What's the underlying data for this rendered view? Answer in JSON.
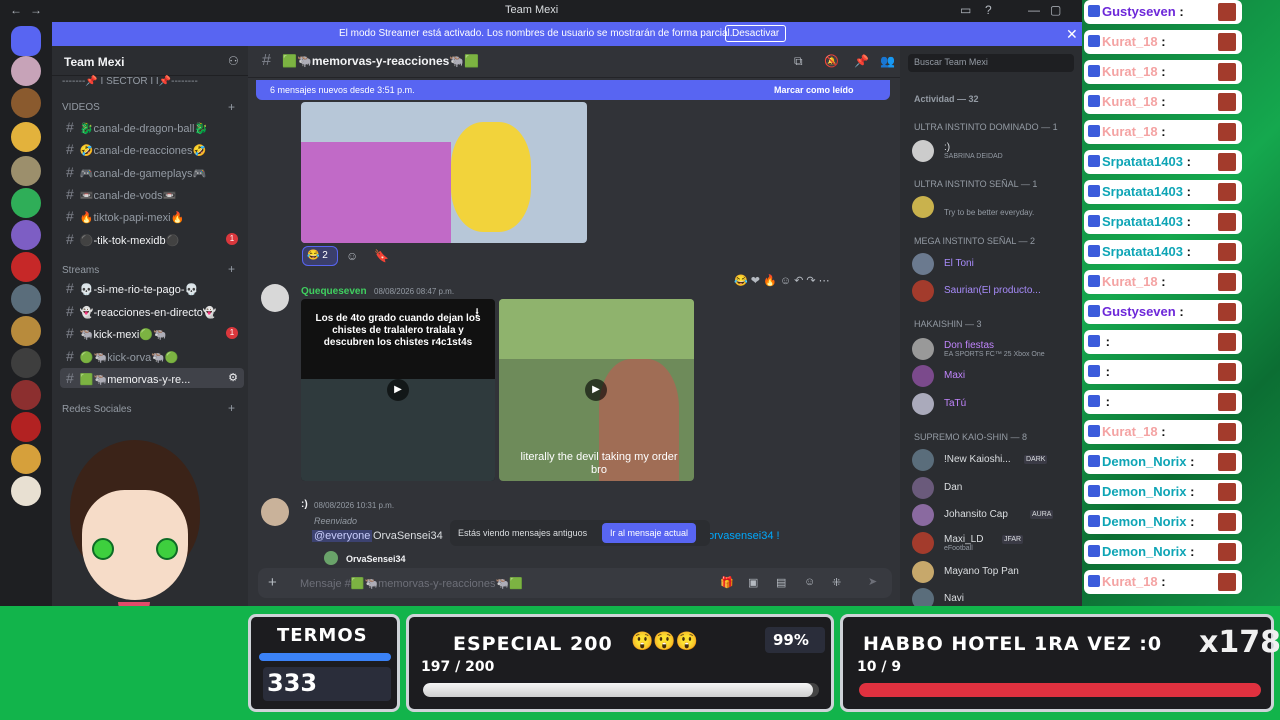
{
  "window": {
    "title": "Team Mexi"
  },
  "banner": {
    "message": "El modo Streamer está activado. Los nombres de usuario se mostrarán de forma parcial.",
    "button": "Desactivar"
  },
  "server": {
    "name": "Team Mexi"
  },
  "sidebar": {
    "cat_sector": "-------📌 I SECTOR I I📌--------",
    "cat_videos": "VIDEOS",
    "cat_streams": "Streams",
    "cat_redes": "Redes Sociales",
    "channels": [
      {
        "label": "🐉canal-de-dragon-ball🐉"
      },
      {
        "label": "🤣canal-de-reacciones🤣"
      },
      {
        "label": "🎮canal-de-gameplays🎮"
      },
      {
        "label": "📼canal-de-vods📼"
      },
      {
        "label": "🔥tiktok-papi-mexi🔥"
      },
      {
        "label": "⚫-tik-tok-mexidb⚫"
      },
      {
        "label": "💀-si-me-rio-te-pago-💀"
      },
      {
        "label": "👻-reacciones-en-directo👻"
      },
      {
        "label": "🐃kick-mexi🟢🐃"
      },
      {
        "label": "🟢🐃kick-orva🐃🟢"
      },
      {
        "label": "🟩🐃memorvas-y-re..."
      }
    ]
  },
  "chat": {
    "channel": "🟩🐃memorvas-y-reacciones🐃🟩",
    "new_messages": "6 mensajes nuevos desde 3:51 p.m.",
    "mark_read": "Marcar como leído",
    "reaction_count": "2",
    "msg1": {
      "author": "Quequeseven",
      "time": "08/08/2026 08:47 p.m."
    },
    "video1_caption": "Los de 4to grado cuando dejan los chistes de tralalero tralala y descubren los chistes r4c1st4s",
    "video2_caption": "literally the devil taking my order bro",
    "msg2": {
      "author": ":)",
      "time": "08/08/2026 10:31 p.m.",
      "forwarded": "Reenviado",
      "mention": "@everyone",
      "text": "OrvaSensei34",
      "link": "orvasensei34 !",
      "embed_author": "OrvaSensei34"
    },
    "old_notice": "Estás viendo mensajes antiguos",
    "jump_button": "Ir al mensaje actual",
    "composer_placeholder": "Mensaje #🟩🐃memorvas-y-reacciones🐃🟩"
  },
  "members": {
    "search_placeholder": "Buscar Team Mexi",
    "activity": "Actividad — 32",
    "groups": [
      {
        "title": "ULTRA INSTINTO DOMINADO — 1",
        "members": [
          {
            "name": ":)",
            "status": "SABRINA DEIDAD",
            "color": "#dbdee1"
          }
        ]
      },
      {
        "title": "ULTRA INSTINTO SEÑAL — 1",
        "members": [
          {
            "name": "Try to be better everyday.",
            "status": "",
            "color": "#949ba4"
          }
        ]
      },
      {
        "title": "MEGA INSTINTO SEÑAL — 2",
        "members": [
          {
            "name": "El Toni",
            "status": "",
            "color": "#a78bfa"
          },
          {
            "name": "Saurian(El producto...",
            "status": "",
            "color": "#a78bfa"
          }
        ]
      },
      {
        "title": "HAKAISHIN — 3",
        "members": [
          {
            "name": "Don fiestas",
            "status": "EA SPORTS FC™ 25 Xbox One",
            "color": "#c084fc"
          },
          {
            "name": "Maxi",
            "status": "",
            "color": "#c084fc"
          },
          {
            "name": "TaTú",
            "status": "",
            "color": "#c084fc"
          }
        ]
      },
      {
        "title": "SUPREMO KAIO-SHIN — 8",
        "members": [
          {
            "name": "!New Kaioshi...",
            "tag": "DARK",
            "status": "",
            "color": "#dbdee1"
          },
          {
            "name": "Dan",
            "status": "",
            "color": "#dbdee1"
          },
          {
            "name": "Johansito Cap",
            "tag": "AURA",
            "status": "",
            "color": "#dbdee1"
          },
          {
            "name": "Maxi_LD",
            "tag": "JFAR",
            "status": "eFootball",
            "color": "#dbdee1"
          },
          {
            "name": "Mayano Top Pan",
            "status": "",
            "color": "#dbdee1"
          },
          {
            "name": "Navi",
            "status": "",
            "color": "#dbdee1"
          }
        ]
      }
    ]
  },
  "overlay_chat": [
    {
      "name": "Gustyseven",
      "color": "#6d28d9"
    },
    {
      "name": "Kurat_18",
      "color": "#f4a3a3"
    },
    {
      "name": "Kurat_18",
      "color": "#f4a3a3"
    },
    {
      "name": "Kurat_18",
      "color": "#f4a3a3"
    },
    {
      "name": "Kurat_18",
      "color": "#f4a3a3"
    },
    {
      "name": "Srpatata1403",
      "color": "#0ea5b5"
    },
    {
      "name": "Srpatata1403",
      "color": "#0ea5b5"
    },
    {
      "name": "Srpatata1403",
      "color": "#0ea5b5"
    },
    {
      "name": "Srpatata1403",
      "color": "#0ea5b5"
    },
    {
      "name": "Kurat_18",
      "color": "#f4a3a3"
    },
    {
      "name": "Gustyseven",
      "color": "#6d28d9"
    },
    {
      "name": "",
      "color": "#111"
    },
    {
      "name": "",
      "color": "#111"
    },
    {
      "name": "",
      "color": "#111"
    },
    {
      "name": "Kurat_18",
      "color": "#f4a3a3"
    },
    {
      "name": "Demon_Norix",
      "color": "#0ea5b5"
    },
    {
      "name": "Demon_Norix",
      "color": "#0ea5b5"
    },
    {
      "name": "Demon_Norix",
      "color": "#0ea5b5"
    },
    {
      "name": "Demon_Norix",
      "color": "#0ea5b5"
    },
    {
      "name": "Kurat_18",
      "color": "#f4a3a3"
    }
  ],
  "stream": {
    "termos": {
      "label": "TERMOS",
      "value": "333"
    },
    "goal1": {
      "title": "ESPECIAL 200",
      "percent": "99%",
      "progress": "197 / 200",
      "fraction": 0.985
    },
    "goal2": {
      "title": "HABBO HOTEL 1RA VEZ :0",
      "progress": "10 / 9",
      "fraction": 1.0,
      "multiplier": "x178"
    }
  },
  "colors": {
    "accent": "#5865f2",
    "green_bg": "#12b44b",
    "red_bar": "#e0313f"
  }
}
